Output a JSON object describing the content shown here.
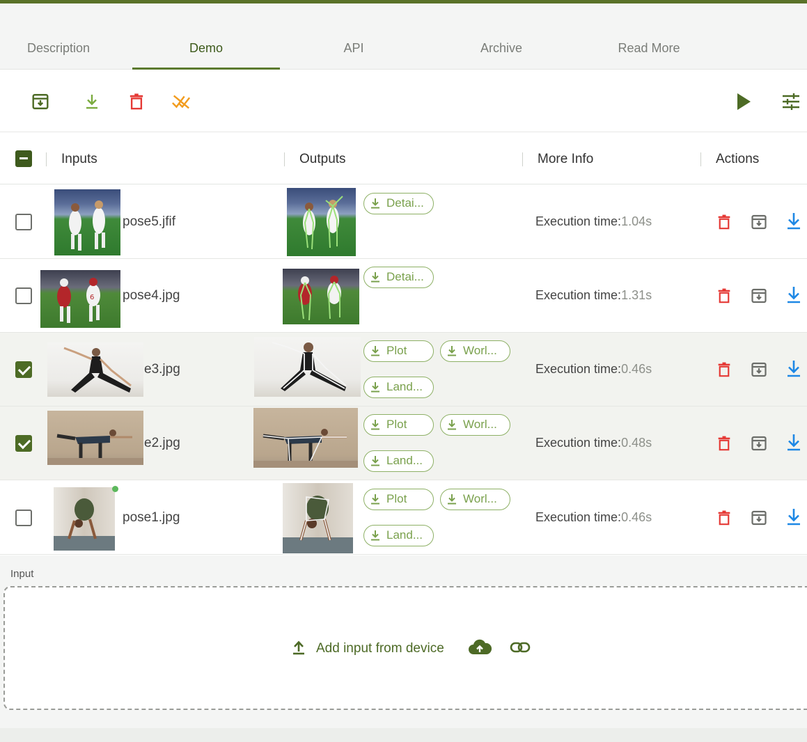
{
  "tabs": [
    {
      "label": "Description"
    },
    {
      "label": "Demo"
    },
    {
      "label": "API"
    },
    {
      "label": "Archive"
    },
    {
      "label": "Read More"
    }
  ],
  "active_tab": "Demo",
  "toolbar": {
    "icons": [
      "archive-icon",
      "download-icon",
      "trash-icon",
      "clear-icon"
    ],
    "right_icons": [
      "play-icon",
      "settings-sliders-icon"
    ]
  },
  "table": {
    "headers": {
      "inputs": "Inputs",
      "outputs": "Outputs",
      "more_info": "More Info",
      "actions": "Actions"
    },
    "rows": [
      {
        "file": "pose5.jfif",
        "selected": false,
        "buttons": [
          "Detai..."
        ],
        "info_label": "Execution time:",
        "info_value": "1.04s"
      },
      {
        "file": "pose4.jpg",
        "selected": false,
        "buttons": [
          "Detai..."
        ],
        "info_label": "Execution time:",
        "info_value": "1.31s"
      },
      {
        "file": "e3.jpg",
        "selected": true,
        "buttons": [
          "Plot",
          "Worl...",
          "Land..."
        ],
        "info_label": "Execution time:",
        "info_value": "0.46s"
      },
      {
        "file": "e2.jpg",
        "selected": true,
        "buttons": [
          "Plot",
          "Worl...",
          "Land..."
        ],
        "info_label": "Execution time:",
        "info_value": "0.48s"
      },
      {
        "file": "pose1.jpg",
        "selected": false,
        "buttons": [
          "Plot",
          "Worl...",
          "Land..."
        ],
        "info_label": "Execution time:",
        "info_value": "0.46s"
      }
    ]
  },
  "input_section": {
    "label": "Input",
    "add_text": "Add input from device"
  },
  "colors": {
    "accent": "#4d6b25",
    "pill": "#8db065",
    "delete": "#e53935",
    "download": "#1e88e5",
    "clear": "#f29c1f"
  }
}
